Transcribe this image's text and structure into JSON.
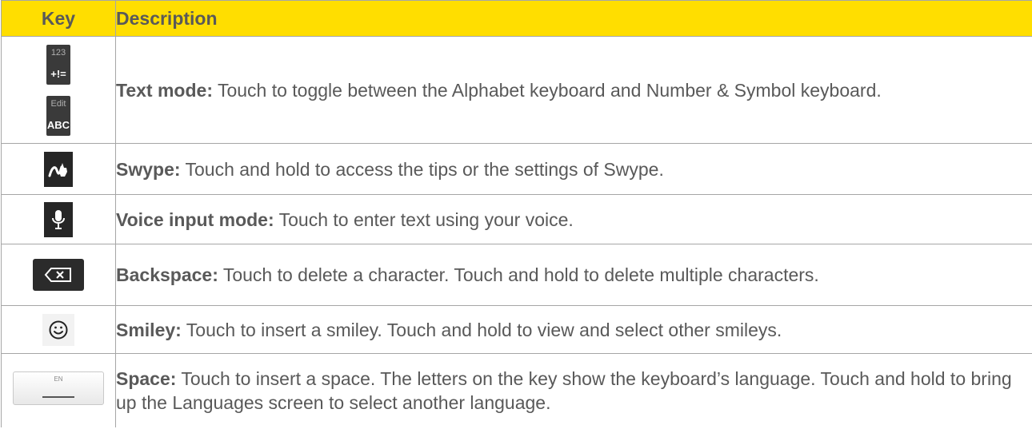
{
  "header": {
    "key": "Key",
    "description": "Description"
  },
  "rows": [
    {
      "term": "Text mode:",
      "text": " Touch to toggle between the Alphabet keyboard and Number & Symbol keyboard.",
      "icons": [
        {
          "name": "number-symbol-key-icon",
          "small": "123",
          "big": "+!="
        },
        {
          "name": "alphabet-key-icon",
          "small": "Edit",
          "big": "ABC"
        }
      ]
    },
    {
      "term": "Swype:",
      "text": " Touch and hold to access the tips or the settings of Swype.",
      "icon": "swype-icon"
    },
    {
      "term": "Voice input mode:",
      "text": " Touch to enter text using your voice.",
      "icon": "microphone-icon"
    },
    {
      "term": "Backspace:",
      "text": " Touch to delete a character. Touch and hold to delete multiple characters.",
      "icon": "backspace-icon"
    },
    {
      "term": "Smiley:",
      "text": " Touch to insert a smiley. Touch and hold to view and select other smileys.",
      "icon": "smiley-icon"
    },
    {
      "term": "Space:",
      "text": " Touch to insert a space. The letters on the key show the keyboard’s language. Touch and hold to bring up the Languages screen to select another language.",
      "icon": "space-key-icon",
      "key_label": "EN"
    }
  ],
  "colors": {
    "header_bg": "#ffde00",
    "text": "#595959",
    "border": "#a6a6a6"
  }
}
